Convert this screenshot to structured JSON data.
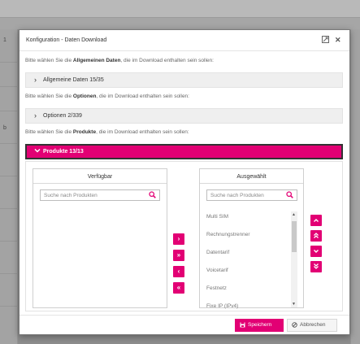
{
  "background": {
    "left_marks": [
      "1",
      "b"
    ]
  },
  "dialog": {
    "title": "Konfiguration - Daten Download",
    "expand_icon": "expand-icon",
    "close_icon": "close-icon"
  },
  "sections": [
    {
      "info_prefix": "Bitte wählen Sie die ",
      "info_bold": "Allgemeinen Daten",
      "info_suffix": ", die im Download enthalten sein sollen:",
      "label": "Allgemeine Daten 15/35",
      "expanded": false
    },
    {
      "info_prefix": "Bitte wählen Sie die ",
      "info_bold": "Optionen",
      "info_suffix": ", die im Download enthalten sein sollen:",
      "label": "Optionen 2/339",
      "expanded": false
    },
    {
      "info_prefix": "Bitte wählen Sie die ",
      "info_bold": "Produkte",
      "info_suffix": ", die im Download enthalten sein sollen:",
      "label": "Produkte 13/13",
      "expanded": true
    }
  ],
  "available": {
    "title": "Verfügbar",
    "search_placeholder": "Suche nach Produkten",
    "items": []
  },
  "selected": {
    "title": "Ausgewählt",
    "search_placeholder": "Suche nach Produkten",
    "items": [
      "Multi SIM",
      "Rechnungstrenner",
      "Datentarif",
      "Voicetarif",
      "Festnetz",
      "Fixe IP (IPv4)"
    ]
  },
  "transfer_buttons": [
    {
      "symbol": "›",
      "name": "move-right-button"
    },
    {
      "symbol": "»",
      "name": "move-all-right-button"
    },
    {
      "symbol": "‹",
      "name": "move-left-button"
    },
    {
      "symbol": "«",
      "name": "move-all-left-button"
    }
  ],
  "order_buttons": [
    {
      "symbol": "⌃",
      "name": "move-up-button"
    },
    {
      "symbol": "⇑",
      "name": "move-top-button"
    },
    {
      "symbol": "⌄",
      "name": "move-down-button"
    },
    {
      "symbol": "⇓",
      "name": "move-bottom-button"
    }
  ],
  "footer": {
    "save_label": "Speichern",
    "cancel_label": "Abbrechen"
  },
  "colors": {
    "accent": "#e20074"
  }
}
